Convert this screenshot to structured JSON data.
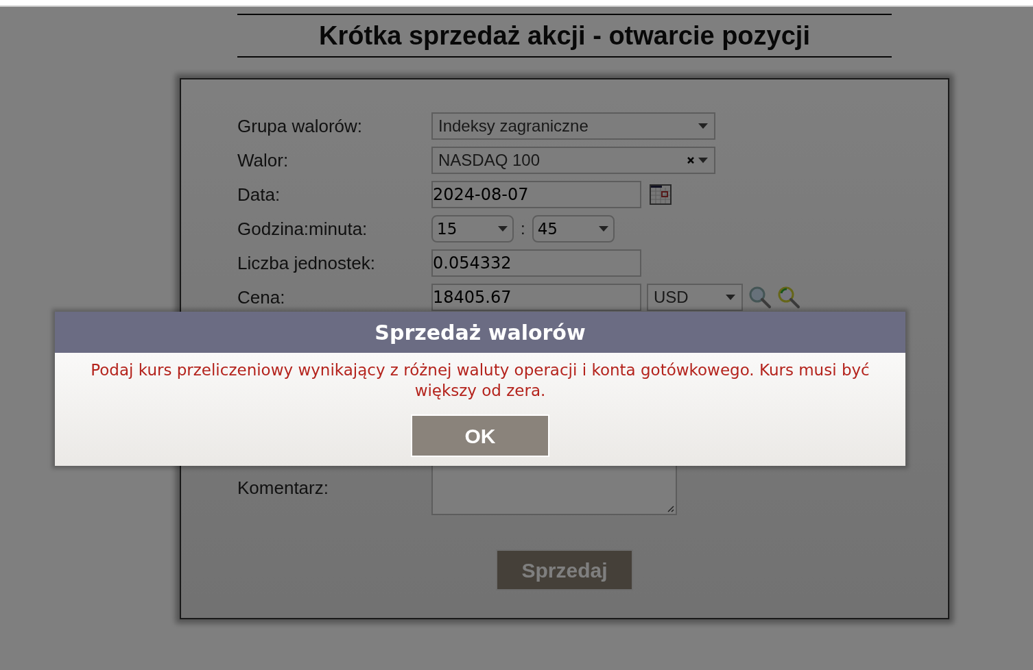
{
  "title": "Krótka sprzedaż akcji - otwarcie pozycji",
  "form": {
    "rows": [
      {
        "kind": "select",
        "label": "Grupa walorów:",
        "value": "Indeksy zagraniczne",
        "clearable": false
      },
      {
        "kind": "select",
        "label": "Walor:",
        "value": "NASDAQ 100",
        "clearable": true
      },
      {
        "kind": "date",
        "label": "Data:",
        "value": "2024-08-07"
      },
      {
        "kind": "time",
        "label": "Godzina:minuta:",
        "hour": "15",
        "separator": ":",
        "minute": "45"
      },
      {
        "kind": "text",
        "label": "Liczba jednostek:",
        "value": "0.054332"
      },
      {
        "kind": "price",
        "label": "Cena:",
        "value": "18405.67",
        "currency": "USD"
      },
      {
        "kind": "textarea",
        "label": "Komentarz:"
      }
    ],
    "submit": "Sprzedaj"
  },
  "dialog": {
    "title": "Sprzedaż walorów",
    "message": "Podaj kurs przeliczeniowy wynikający z różnej waluty operacji i konta gotówkowego. Kurs musi być większy od zera.",
    "button": "OK"
  }
}
